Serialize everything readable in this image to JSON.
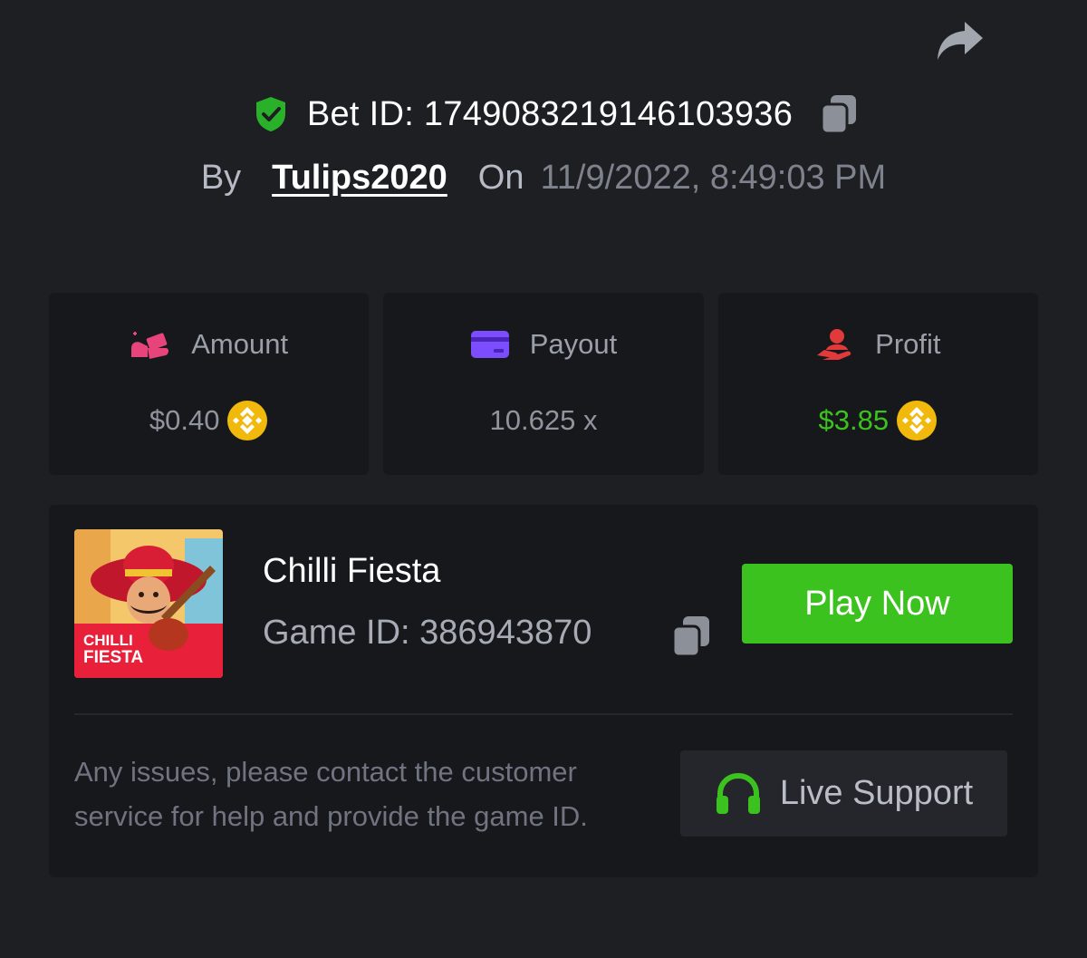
{
  "header": {
    "bet_id_label": "Bet ID: 1749083219146103936",
    "by_label": "By",
    "username": "Tulips2020",
    "on_label": "On",
    "datetime": "11/9/2022, 8:49:03 PM"
  },
  "stats": {
    "amount": {
      "label": "Amount",
      "value": "$0.40",
      "icon": "money-hand-icon"
    },
    "payout": {
      "label": "Payout",
      "value": "10.625 x",
      "icon": "credit-card-icon"
    },
    "profit": {
      "label": "Profit",
      "value": "$3.85",
      "icon": "profit-hand-icon",
      "color": "#3cc21f"
    }
  },
  "game": {
    "title": "Chilli Fiesta",
    "game_id_label": "Game ID: 386943870",
    "thumb_logo_line1": "CHILLI",
    "thumb_logo_line2": "FIESTA",
    "play_label": "Play Now"
  },
  "support": {
    "help_text": "Any issues, please contact the customer service for help and provide the game ID.",
    "button_label": "Live Support"
  },
  "colors": {
    "background": "#1e1f23",
    "card": "#17181b",
    "accent_green": "#3cc21f",
    "amount_icon": "#e8447c",
    "payout_icon": "#7c4dff",
    "profit_icon": "#e23a3a",
    "coin": "#f0b90b"
  }
}
